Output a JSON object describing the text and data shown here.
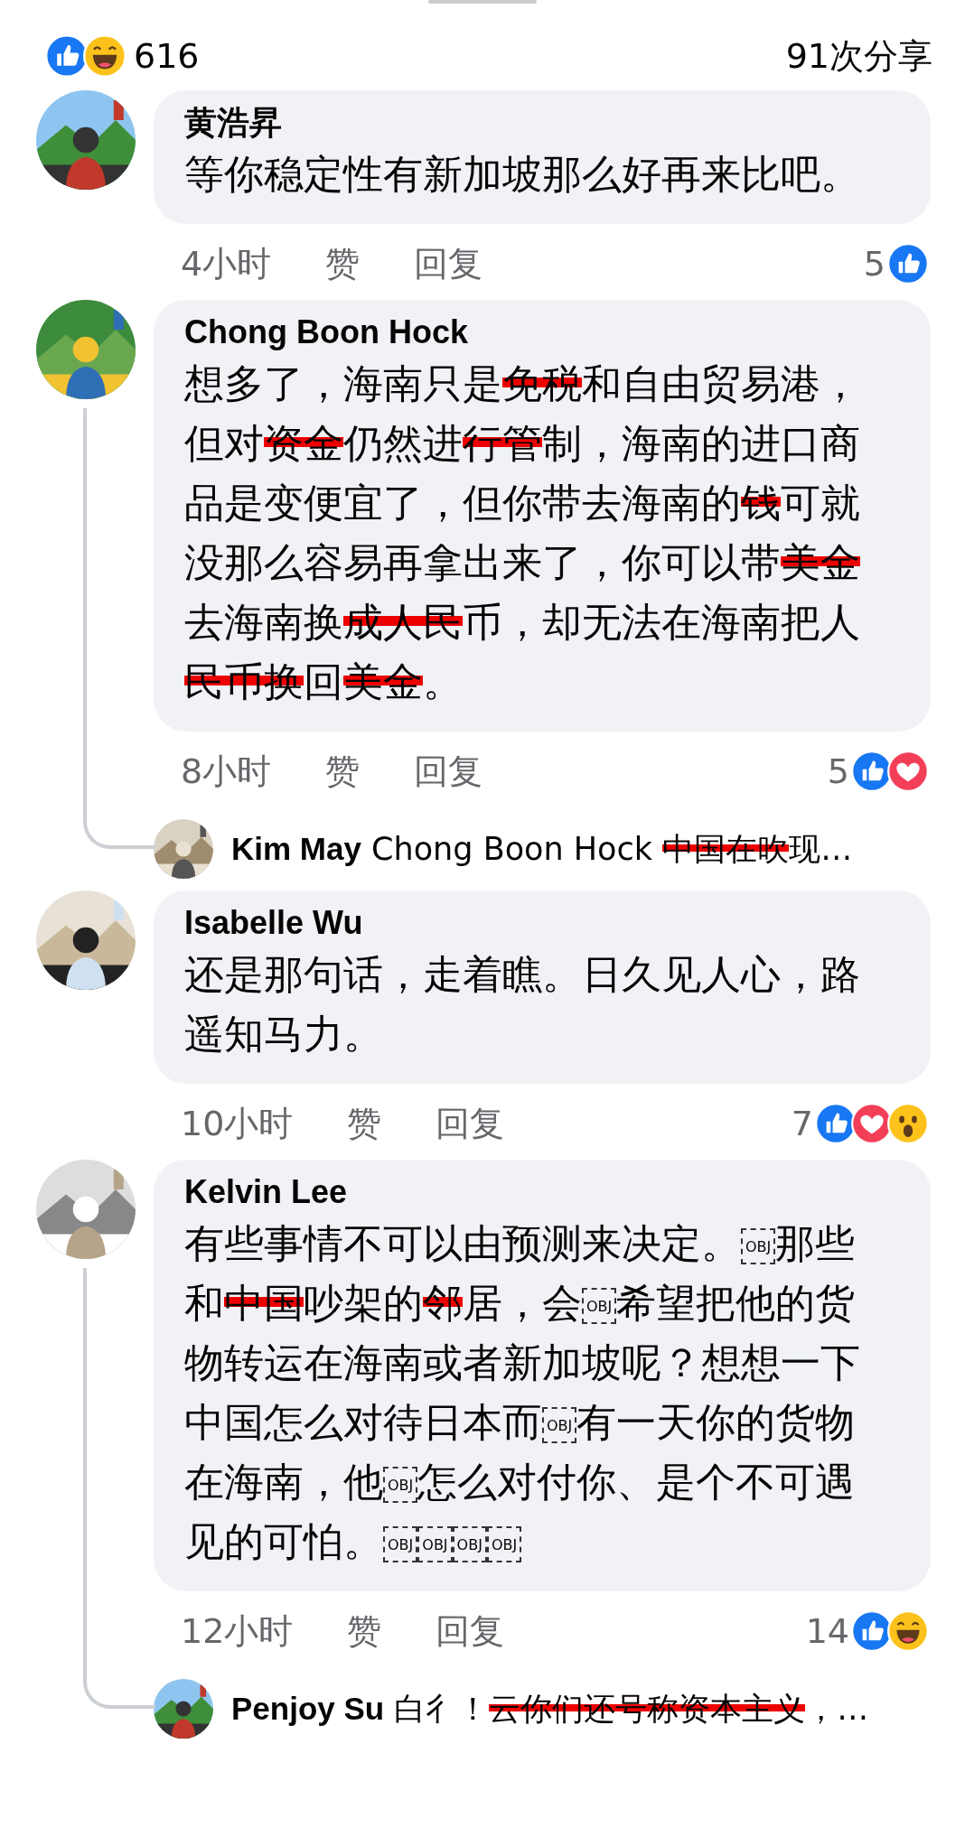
{
  "summary": {
    "reactions": [
      {
        "kind": "like"
      },
      {
        "kind": "haha"
      }
    ],
    "count": "616",
    "shares": "91次分享"
  },
  "comments": [
    {
      "author": "黄浩昇",
      "segments": [
        {
          "text": "等你稳定性有新加坡那么好再来比吧。",
          "kind": "plain"
        }
      ],
      "time": "4小时",
      "like_label": "赞",
      "reply_label": "回复",
      "reaction_count": "5",
      "reactions": [
        {
          "kind": "like"
        }
      ]
    },
    {
      "author": "Chong Boon Hock",
      "segments": [
        {
          "text": "想多了，海南只是",
          "kind": "plain"
        },
        {
          "text": "免税",
          "kind": "scribbled"
        },
        {
          "text": "和自由贸易港，但对",
          "kind": "plain"
        },
        {
          "text": "资金",
          "kind": "scribbled"
        },
        {
          "text": "仍然进",
          "kind": "plain"
        },
        {
          "text": "行管",
          "kind": "scribbled"
        },
        {
          "text": "制，海南的进口商品是变便宜了，但你带去海南的",
          "kind": "plain"
        },
        {
          "text": "钱",
          "kind": "scribbled"
        },
        {
          "text": "可就没那么容易再拿出来了，你可以带",
          "kind": "plain"
        },
        {
          "text": "美金",
          "kind": "scribbled"
        },
        {
          "text": "去海南换",
          "kind": "plain"
        },
        {
          "text": "成人民",
          "kind": "scribbled"
        },
        {
          "text": "币，却无法在海南把人",
          "kind": "plain"
        },
        {
          "text": "民币换",
          "kind": "scribbled"
        },
        {
          "text": "回",
          "kind": "plain"
        },
        {
          "text": "美金",
          "kind": "scribbled"
        },
        {
          "text": "。",
          "kind": "plain"
        }
      ],
      "time": "8小时",
      "like_label": "赞",
      "reply_label": "回复",
      "reaction_count": "5",
      "reactions": [
        {
          "kind": "like"
        },
        {
          "kind": "love"
        }
      ],
      "replies": [
        {
          "author": "Kim May",
          "segments": [
            {
              "text": "Chong Boon Hock ",
              "kind": "plain"
            },
            {
              "text": "中国在吹",
              "kind": "scribbled"
            },
            {
              "text": "现…",
              "kind": "plain"
            }
          ]
        }
      ]
    },
    {
      "author": "Isabelle Wu",
      "segments": [
        {
          "text": "还是那句话，走着瞧。日久见人心，路遥知马力。",
          "kind": "plain"
        }
      ],
      "time": "10小时",
      "like_label": "赞",
      "reply_label": "回复",
      "reaction_count": "7",
      "reactions": [
        {
          "kind": "like"
        },
        {
          "kind": "love"
        },
        {
          "kind": "wow"
        }
      ]
    },
    {
      "author": "Kelvin Lee",
      "segments": [
        {
          "text": "有些事情不可以由预测来决定。",
          "kind": "plain"
        },
        {
          "text": "OBJ",
          "kind": "obj"
        },
        {
          "text": "那些和",
          "kind": "plain"
        },
        {
          "text": "中国",
          "kind": "scribbled"
        },
        {
          "text": "吵架的",
          "kind": "plain"
        },
        {
          "text": "邻",
          "kind": "scribbled"
        },
        {
          "text": "居，会",
          "kind": "plain"
        },
        {
          "text": "OBJ",
          "kind": "obj"
        },
        {
          "text": "希望把他的货物转运在海南或者新加坡呢？想想一下中国怎么对待日本而",
          "kind": "plain"
        },
        {
          "text": "OBJ",
          "kind": "obj"
        },
        {
          "text": "有一天你的货物在海南，他",
          "kind": "plain"
        },
        {
          "text": "OBJ",
          "kind": "obj"
        },
        {
          "text": "怎么对付你、是个不可遇见的可怕。",
          "kind": "plain"
        },
        {
          "text": "OBJ",
          "kind": "obj"
        },
        {
          "text": "OBJ",
          "kind": "obj"
        },
        {
          "text": "OBJ",
          "kind": "obj"
        },
        {
          "text": "OBJ",
          "kind": "obj"
        }
      ],
      "time": "12小时",
      "like_label": "赞",
      "reply_label": "回复",
      "reaction_count": "14",
      "reactions": [
        {
          "kind": "like"
        },
        {
          "kind": "haha"
        }
      ],
      "replies": [
        {
          "author": "Penjoy Su",
          "segments": [
            {
              "text": "白彳！",
              "kind": "plain"
            },
            {
              "text": "云你们还号称资本主义",
              "kind": "scribbled"
            },
            {
              "text": "，…",
              "kind": "plain"
            }
          ]
        }
      ]
    }
  ]
}
